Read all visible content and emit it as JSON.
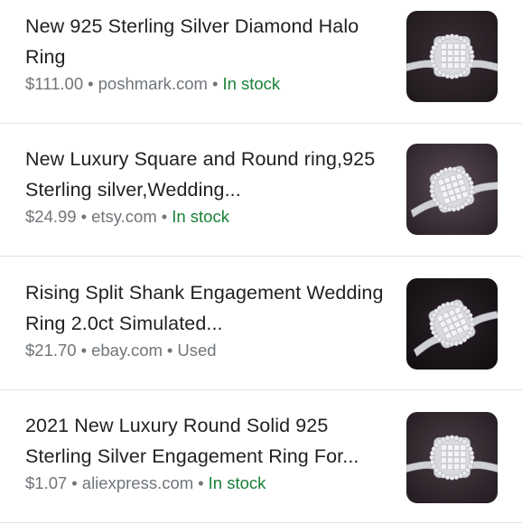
{
  "results": [
    {
      "title": "New 925 Sterling Silver Diamond Halo Ring",
      "price": "$111.00",
      "store": "poshmark.com",
      "status": "In stock",
      "status_type": "in-stock",
      "image_icon": "ring-image"
    },
    {
      "title": "New Luxury Square and Round ring,925 Sterling silver,Wedding...",
      "price": "$24.99",
      "store": "etsy.com",
      "status": "In stock",
      "status_type": "in-stock",
      "image_icon": "ring-image"
    },
    {
      "title": "Rising Split Shank Engagement Wedding Ring 2.0ct Simulated...",
      "price": "$21.70",
      "store": "ebay.com",
      "status": "Used",
      "status_type": "used",
      "image_icon": "ring-image"
    },
    {
      "title": "2021 New Luxury Round Solid 925 Sterling Silver Engagement Ring For...",
      "price": "$1.07",
      "store": "aliexpress.com",
      "status": "In stock",
      "status_type": "in-stock",
      "image_icon": "ring-image"
    }
  ],
  "separator": "•",
  "colors": {
    "title": "#202124",
    "meta": "#70757a",
    "in_stock": "#188038",
    "divider": "#e3e3e3"
  }
}
